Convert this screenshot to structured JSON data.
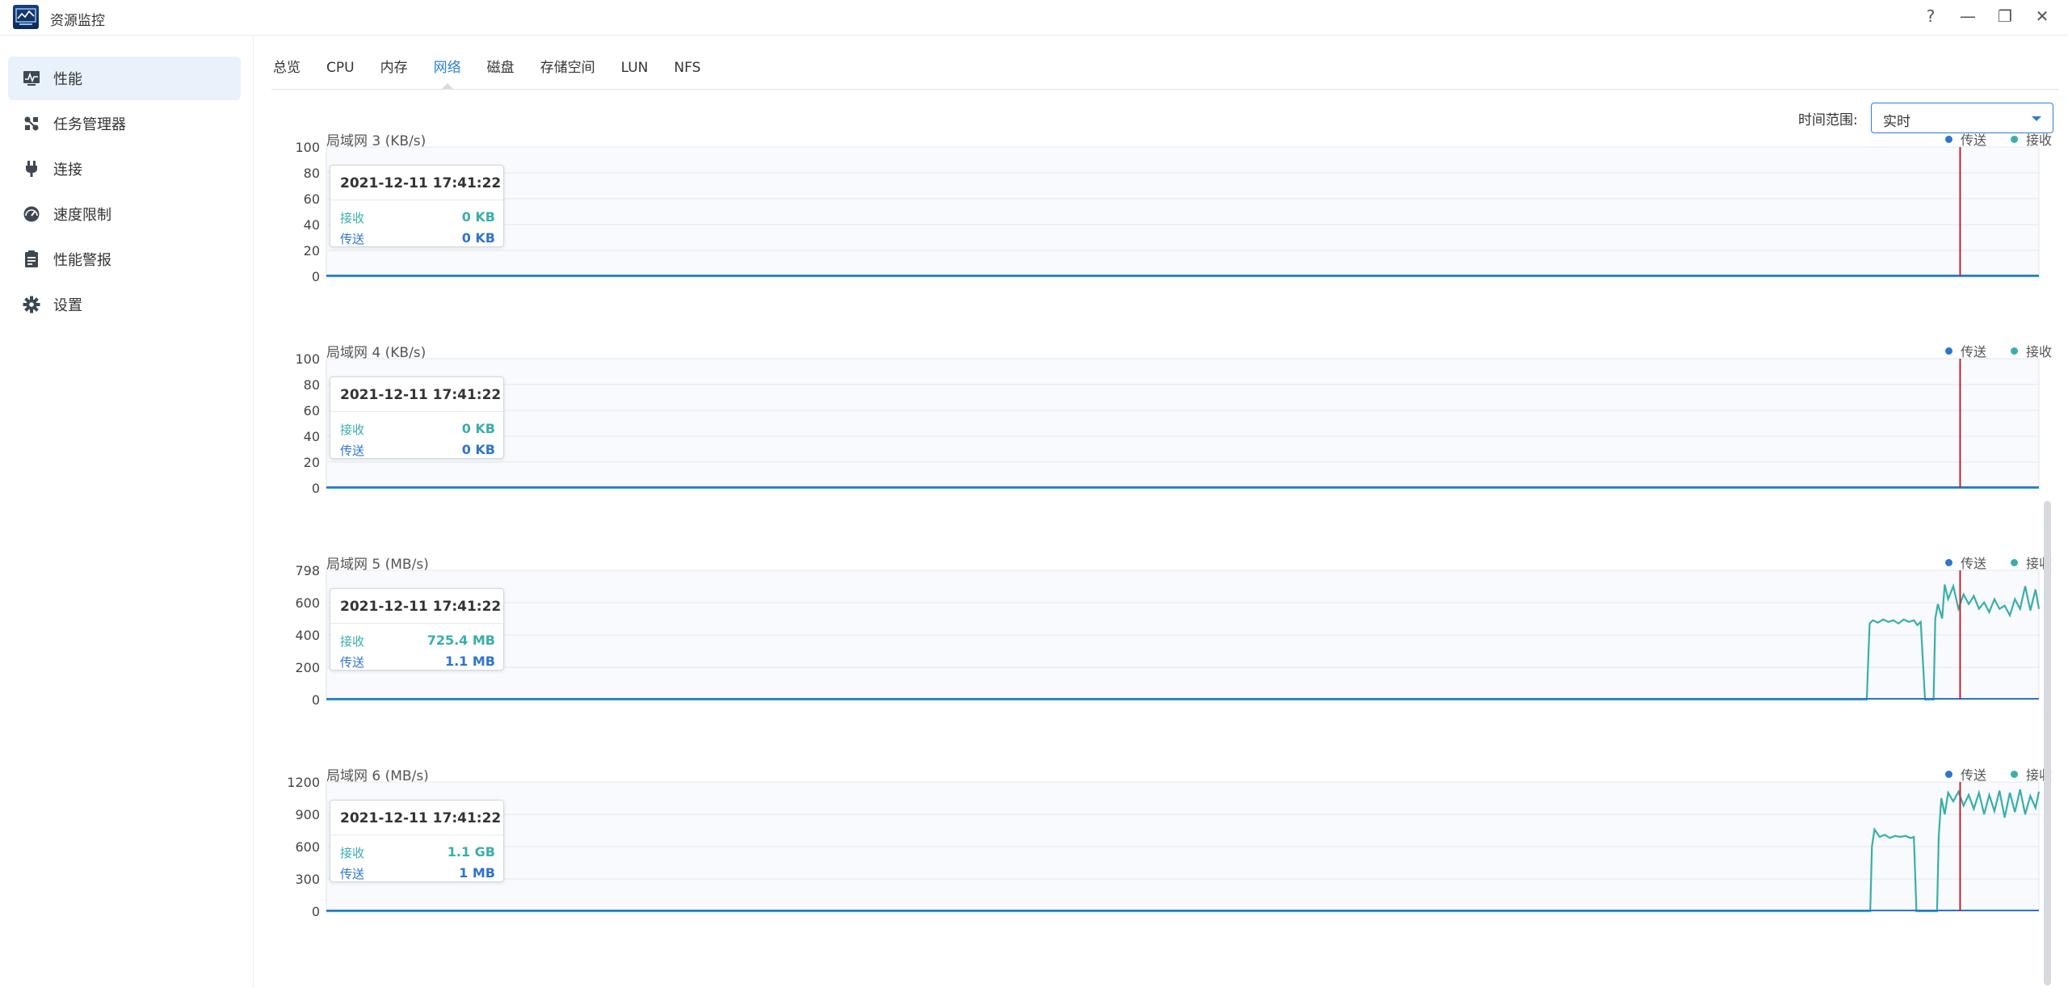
{
  "app": {
    "title": "资源监控"
  },
  "window_controls": {
    "help": "?",
    "minimize": "—",
    "restore": "❐",
    "close": "✕"
  },
  "sidebar": {
    "items": [
      {
        "label": "性能",
        "icon": "performance-icon",
        "active": true
      },
      {
        "label": "任务管理器",
        "icon": "task-manager-icon",
        "active": false
      },
      {
        "label": "连接",
        "icon": "plug-icon",
        "active": false
      },
      {
        "label": "速度限制",
        "icon": "speed-limit-icon",
        "active": false
      },
      {
        "label": "性能警报",
        "icon": "alert-clipboard-icon",
        "active": false
      },
      {
        "label": "设置",
        "icon": "gear-icon",
        "active": false
      }
    ]
  },
  "tabs": [
    {
      "label": "总览",
      "active": false
    },
    {
      "label": "CPU",
      "active": false
    },
    {
      "label": "内存",
      "active": false
    },
    {
      "label": "网络",
      "active": true
    },
    {
      "label": "磁盘",
      "active": false
    },
    {
      "label": "存储空间",
      "active": false
    },
    {
      "label": "LUN",
      "active": false
    },
    {
      "label": "NFS",
      "active": false
    }
  ],
  "time_range": {
    "label": "时间范围:",
    "value": "实时"
  },
  "colors": {
    "send": "#2f74d0",
    "receive": "#3aaeaa",
    "marker": "#c0272d",
    "accent": "#2c7fd3"
  },
  "legend": {
    "send": "传送",
    "receive": "接收"
  },
  "charts": [
    {
      "title": "局域网 3 (KB/s)",
      "ymax": 100,
      "yticks": [
        "100",
        "80",
        "60",
        "40",
        "20",
        "0"
      ],
      "tooltip": {
        "time": "2021-12-11 17:41:22",
        "receive_label": "接收",
        "receive_value": "0 KB",
        "send_label": "传送",
        "send_value": "0 KB"
      }
    },
    {
      "title": "局域网 4 (KB/s)",
      "ymax": 100,
      "yticks": [
        "100",
        "80",
        "60",
        "40",
        "20",
        "0"
      ],
      "tooltip": {
        "time": "2021-12-11 17:41:22",
        "receive_label": "接收",
        "receive_value": "0 KB",
        "send_label": "传送",
        "send_value": "0 KB"
      }
    },
    {
      "title": "局域网 5 (MB/s)",
      "ymax": 798,
      "yticks": [
        "798",
        "600",
        "400",
        "200",
        "0"
      ],
      "tooltip": {
        "time": "2021-12-11 17:41:22",
        "receive_label": "接收",
        "receive_value": "725.4 MB",
        "send_label": "传送",
        "send_value": "1.1 MB"
      }
    },
    {
      "title": "局域网 6 (MB/s)",
      "ymax": 1200,
      "yticks": [
        "1200",
        "900",
        "600",
        "300",
        "0"
      ],
      "tooltip": {
        "time": "2021-12-11 17:41:22",
        "receive_label": "接收",
        "receive_value": "1.1 GB",
        "send_label": "传送",
        "send_value": "1 MB"
      }
    }
  ]
}
